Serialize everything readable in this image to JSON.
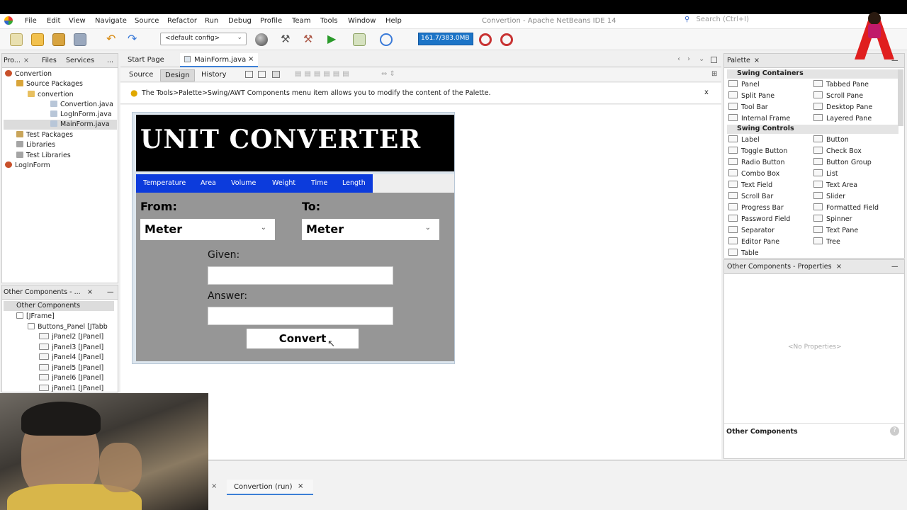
{
  "window": {
    "title": "Convertion - Apache NetBeans IDE 14",
    "search_placeholder": "Search (Ctrl+I)"
  },
  "menu": [
    "File",
    "Edit",
    "View",
    "Navigate",
    "Source",
    "Refactor",
    "Run",
    "Debug",
    "Profile",
    "Team",
    "Tools",
    "Window",
    "Help"
  ],
  "toolbar": {
    "config": "<default config>",
    "memory": "161.7/383.0MB"
  },
  "projects": {
    "tabs": [
      "Pro...",
      "Files",
      "Services",
      "..."
    ],
    "tree": [
      "Convertion",
      "Source Packages",
      "convertion",
      "Convertion.java",
      "LogInForm.java",
      "MainForm.java",
      "Test Packages",
      "Libraries",
      "Test Libraries",
      "LogInForm"
    ]
  },
  "navigator": {
    "title": "Other Components - ...",
    "tree": [
      "Other Components",
      "[JFrame]",
      "Buttons_Panel [JTabb",
      "jPanel2 [JPanel]",
      "jPanel3 [JPanel]",
      "jPanel4 [JPanel]",
      "jPanel5 [JPanel]",
      "jPanel6 [JPanel]",
      "jPanel1 [JPanel]"
    ]
  },
  "editor": {
    "tabs": [
      "Start Page",
      "MainForm.java"
    ],
    "views": [
      "Source",
      "Design",
      "History"
    ],
    "hint": "The Tools>Palette>Swing/AWT Components menu item allows you to modify the content of the Palette.",
    "hint_close": "x"
  },
  "form": {
    "title": "UNIT CONVERTER",
    "nav": [
      "Temperature",
      "Area",
      "Volume",
      "Weight",
      "Time",
      "Length"
    ],
    "from_label": "From:",
    "to_label": "To:",
    "from_value": "Meter",
    "to_value": "Meter",
    "given_label": "Given:",
    "answer_label": "Answer:",
    "convert_label": "Convert"
  },
  "palette": {
    "title": "Palette",
    "categories": [
      "Swing Containers",
      "Swing Controls"
    ],
    "containers": [
      "Panel",
      "Tabbed Pane",
      "Split Pane",
      "Scroll Pane",
      "Tool Bar",
      "Desktop Pane",
      "Internal Frame",
      "Layered Pane"
    ],
    "controls": [
      "Label",
      "Button",
      "Toggle Button",
      "Check Box",
      "Radio Button",
      "Button Group",
      "Combo Box",
      "List",
      "Text Field",
      "Text Area",
      "Scroll Bar",
      "Slider",
      "Progress Bar",
      "Formatted Field",
      "Password Field",
      "Spinner",
      "Separator",
      "Text Pane",
      "Editor Pane",
      "Tree",
      "Table"
    ]
  },
  "properties": {
    "title": "Other Components - Properties",
    "empty": "<No Properties>",
    "footer": "Other Components"
  },
  "output": {
    "tab": "Convertion (run)"
  }
}
